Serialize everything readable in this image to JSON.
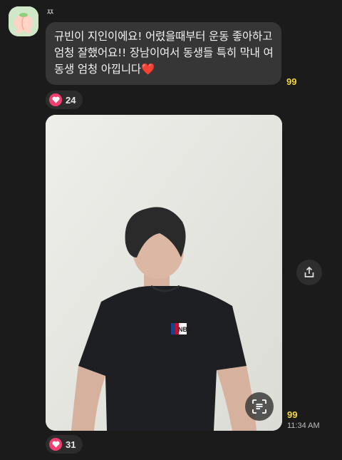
{
  "sender": {
    "name": "ㅉ"
  },
  "message1": {
    "text": "규빈이 지인이에요! 어렸을때부터 운동 좋아하고 엄청 잘했어요!! 장남이여서 동생들 특히 막내 여동생 엄청 아낍니다",
    "emoji": "❤️",
    "unread": "99",
    "reaction": {
      "icon": "heart-icon",
      "count": "24"
    }
  },
  "message2": {
    "type": "photo",
    "shirt_logo": "NBA",
    "unread": "99",
    "time": "11:34 AM",
    "reaction": {
      "icon": "heart-icon",
      "count": "31"
    }
  },
  "colors": {
    "background": "#1b1b1b",
    "bubble": "#363636",
    "unread": "#f5d742",
    "reaction_heart": "#f23f6f"
  }
}
